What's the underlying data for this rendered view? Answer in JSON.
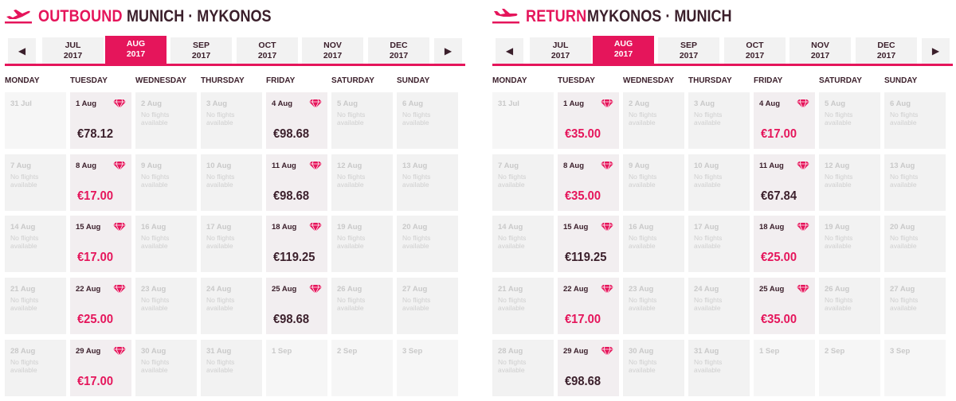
{
  "colors": {
    "accent": "#e5155b",
    "dark": "#3b1f2b",
    "cell": "#f2f2f2"
  },
  "weekdays": [
    "MONDAY",
    "TUESDAY",
    "WEDNESDAY",
    "THURSDAY",
    "FRIDAY",
    "SATURDAY",
    "SUNDAY"
  ],
  "no_flights_text": "No flights available",
  "panels": [
    {
      "direction": "OUTBOUND",
      "route": "MUNICH · MYKONOS",
      "icon": "plane-takeoff-icon",
      "months": [
        {
          "m": "JUL",
          "y": "2017"
        },
        {
          "m": "AUG",
          "y": "2017",
          "active": true
        },
        {
          "m": "SEP",
          "y": "2017"
        },
        {
          "m": "OCT",
          "y": "2017"
        },
        {
          "m": "NOV",
          "y": "2017"
        },
        {
          "m": "DEC",
          "y": "2017"
        }
      ],
      "weeks": [
        [
          {
            "d": "31 Jul",
            "empty": true
          },
          {
            "d": "1 Aug",
            "price": "€78.12",
            "pink": false
          },
          {
            "d": "2 Aug"
          },
          {
            "d": "3 Aug"
          },
          {
            "d": "4 Aug",
            "price": "€98.68",
            "pink": false
          },
          {
            "d": "5 Aug"
          },
          {
            "d": "6 Aug"
          }
        ],
        [
          {
            "d": "7 Aug"
          },
          {
            "d": "8 Aug",
            "price": "€17.00",
            "pink": true
          },
          {
            "d": "9 Aug"
          },
          {
            "d": "10 Aug"
          },
          {
            "d": "11 Aug",
            "price": "€98.68",
            "pink": false
          },
          {
            "d": "12 Aug"
          },
          {
            "d": "13 Aug"
          }
        ],
        [
          {
            "d": "14 Aug"
          },
          {
            "d": "15 Aug",
            "price": "€17.00",
            "pink": true
          },
          {
            "d": "16 Aug"
          },
          {
            "d": "17 Aug"
          },
          {
            "d": "18 Aug",
            "price": "€119.25",
            "pink": false
          },
          {
            "d": "19 Aug"
          },
          {
            "d": "20 Aug"
          }
        ],
        [
          {
            "d": "21 Aug"
          },
          {
            "d": "22 Aug",
            "price": "€25.00",
            "pink": true
          },
          {
            "d": "23 Aug"
          },
          {
            "d": "24 Aug"
          },
          {
            "d": "25 Aug",
            "price": "€98.68",
            "pink": false
          },
          {
            "d": "26 Aug"
          },
          {
            "d": "27 Aug"
          }
        ],
        [
          {
            "d": "28 Aug"
          },
          {
            "d": "29 Aug",
            "price": "€17.00",
            "pink": true
          },
          {
            "d": "30 Aug"
          },
          {
            "d": "31 Aug"
          },
          {
            "d": "1 Sep",
            "empty": true
          },
          {
            "d": "2 Sep",
            "empty": true
          },
          {
            "d": "3 Sep",
            "empty": true
          }
        ]
      ]
    },
    {
      "direction": "RETURN",
      "route": "MYKONOS · MUNICH",
      "icon": "plane-landing-icon",
      "months": [
        {
          "m": "JUL",
          "y": "2017"
        },
        {
          "m": "AUG",
          "y": "2017",
          "active": true
        },
        {
          "m": "SEP",
          "y": "2017"
        },
        {
          "m": "OCT",
          "y": "2017"
        },
        {
          "m": "NOV",
          "y": "2017"
        },
        {
          "m": "DEC",
          "y": "2017"
        }
      ],
      "weeks": [
        [
          {
            "d": "31 Jul",
            "empty": true
          },
          {
            "d": "1 Aug",
            "price": "€35.00",
            "pink": true
          },
          {
            "d": "2 Aug"
          },
          {
            "d": "3 Aug"
          },
          {
            "d": "4 Aug",
            "price": "€17.00",
            "pink": true
          },
          {
            "d": "5 Aug"
          },
          {
            "d": "6 Aug"
          }
        ],
        [
          {
            "d": "7 Aug"
          },
          {
            "d": "8 Aug",
            "price": "€35.00",
            "pink": true
          },
          {
            "d": "9 Aug"
          },
          {
            "d": "10 Aug"
          },
          {
            "d": "11 Aug",
            "price": "€67.84",
            "pink": false
          },
          {
            "d": "12 Aug"
          },
          {
            "d": "13 Aug"
          }
        ],
        [
          {
            "d": "14 Aug"
          },
          {
            "d": "15 Aug",
            "price": "€119.25",
            "pink": false
          },
          {
            "d": "16 Aug"
          },
          {
            "d": "17 Aug"
          },
          {
            "d": "18 Aug",
            "price": "€25.00",
            "pink": true
          },
          {
            "d": "19 Aug"
          },
          {
            "d": "20 Aug"
          }
        ],
        [
          {
            "d": "21 Aug"
          },
          {
            "d": "22 Aug",
            "price": "€17.00",
            "pink": true
          },
          {
            "d": "23 Aug"
          },
          {
            "d": "24 Aug"
          },
          {
            "d": "25 Aug",
            "price": "€35.00",
            "pink": true
          },
          {
            "d": "26 Aug"
          },
          {
            "d": "27 Aug"
          }
        ],
        [
          {
            "d": "28 Aug"
          },
          {
            "d": "29 Aug",
            "price": "€98.68",
            "pink": false
          },
          {
            "d": "30 Aug"
          },
          {
            "d": "31 Aug"
          },
          {
            "d": "1 Sep",
            "empty": true
          },
          {
            "d": "2 Sep",
            "empty": true
          },
          {
            "d": "3 Sep",
            "empty": true
          }
        ]
      ]
    }
  ]
}
